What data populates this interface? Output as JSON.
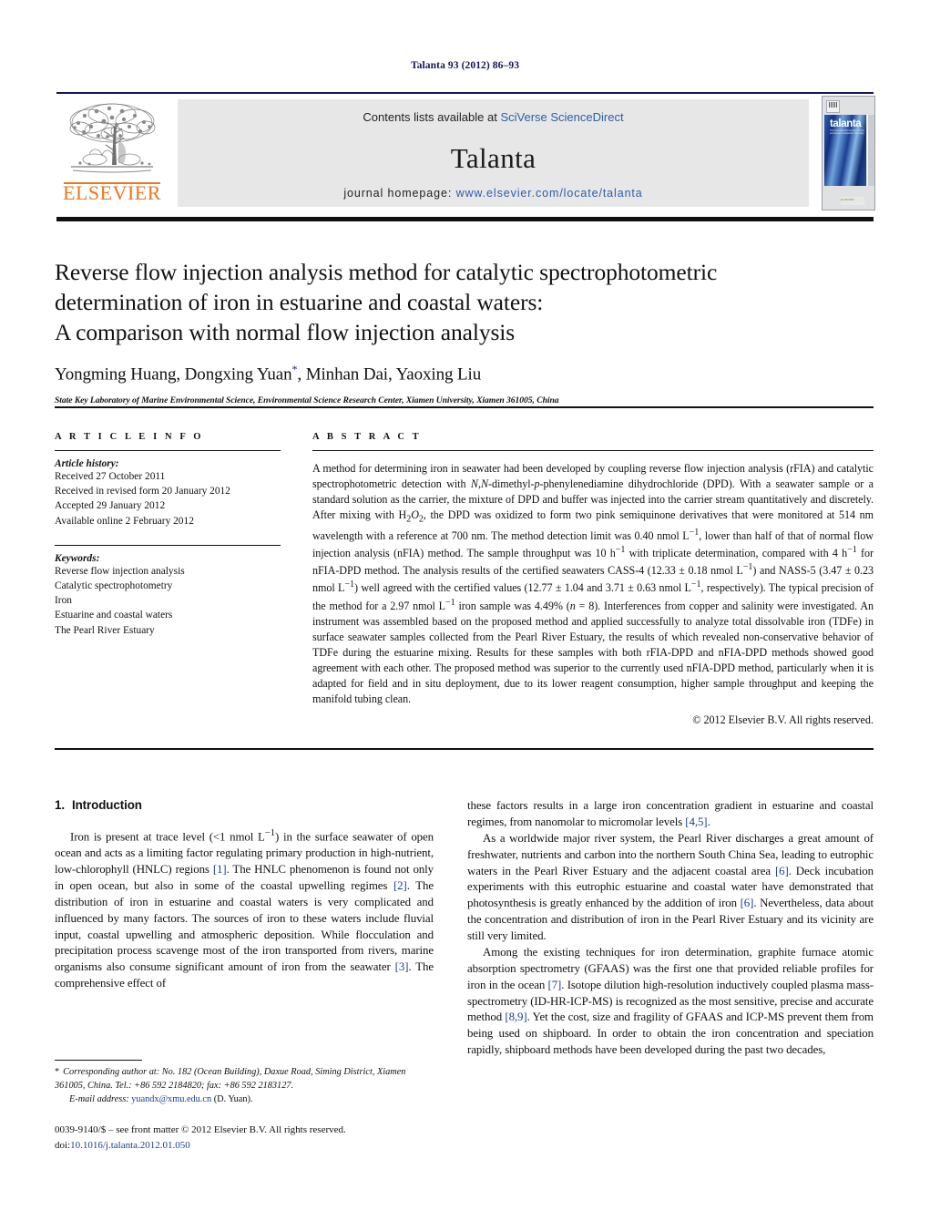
{
  "running_head": "Talanta 93 (2012) 86–93",
  "masthead": {
    "publisher": "ELSEVIER",
    "contents_prefix": "Contents lists available at ",
    "contents_link": "SciVerse ScienceDirect",
    "journal_name": "Talanta",
    "homepage_prefix": "journal homepage: ",
    "homepage_url": "www.elsevier.com/locate/talanta",
    "cover_title": "talanta",
    "cover_subtitle": "The International Journal of Pure and Applied Analytical Chemistry"
  },
  "article": {
    "title_lines": [
      "Reverse flow injection analysis method for catalytic spectrophotometric",
      "determination of iron in estuarine and coastal waters:",
      "A comparison with normal flow injection analysis"
    ],
    "authors": "Yongming Huang, Dongxing Yuan",
    "authors_marker": "*",
    "authors_rest": ", Minhan Dai, Yaoxing Liu",
    "affiliation": "State Key Laboratory of Marine Environmental Science, Environmental Science Research Center, Xiamen University, Xiamen 361005, China"
  },
  "article_info": {
    "heading": "A R T I C L E    I N F O",
    "history_label": "Article history:",
    "history": [
      "Received 27 October 2011",
      "Received in revised form 20 January 2012",
      "Accepted 29 January 2012",
      "Available online 2 February 2012"
    ],
    "keywords_label": "Keywords:",
    "keywords": [
      "Reverse flow injection analysis",
      "Catalytic spectrophotometry",
      "Iron",
      "Estuarine and coastal waters",
      "The Pearl River Estuary"
    ]
  },
  "abstract": {
    "heading": "A B S T R A C T",
    "text_part1": "A method for determining iron in seawater had been developed by coupling reverse flow injection analysis (rFIA) and catalytic spectrophotometric detection with ",
    "ital1": "N",
    "text_part2": ",",
    "ital2": "N",
    "text_part3": "-dimethyl-",
    "ital3": "p",
    "text_part4": "-phenylenediamine dihydrochloride (DPD). With a seawater sample or a standard solution as the carrier, the mixture of DPD and buffer was injected into the carrier stream quantitatively and discretely. After mixing with ",
    "h2o2": "H2O2",
    "text_part5": ", the DPD was oxidized to form two pink semiquinone derivatives that were monitored at 514 nm wavelength with a reference at 700 nm. The method detection limit was 0.40 nmol L",
    "sup1": "−1",
    "text_part6": ", lower than half of that of normal flow injection analysis (nFIA) method. The sample throughput was 10 h",
    "sup2": "−1",
    "text_part7": " with triplicate determination, compared with 4 h",
    "sup3": "−1",
    "text_part8": " for nFIA-DPD method. The analysis results of the certified seawaters CASS-4 (12.33 ± 0.18 nmol L",
    "sup4": "−1",
    "text_part9": ") and NASS-5 (3.47 ± 0.23 nmol L",
    "sup5": "−1",
    "text_part10": ") well agreed with the certified values (12.77 ± 1.04 and 3.71 ± 0.63 nmol L",
    "sup6": "−1",
    "text_part11": ", respectively). The typical precision of the method for a 2.97 nmol L",
    "sup7": "−1",
    "text_part12": " iron sample was 4.49% (",
    "ital_n": "n",
    "text_part13": " = 8). Interferences from copper and salinity were investigated. An instrument was assembled based on the proposed method and applied successfully to analyze total dissolvable iron (TDFe) in surface seawater samples collected from the Pearl River Estuary, the results of which revealed non-conservative behavior of TDFe during the estuarine mixing. Results for these samples with both rFIA-DPD and nFIA-DPD methods showed good agreement with each other. The proposed method was superior to the currently used nFIA-DPD method, particularly when it is adapted for field and in situ deployment, due to its lower reagent consumption, higher sample throughput and keeping the manifold tubing clean.",
    "copyright": "© 2012 Elsevier B.V. All rights reserved."
  },
  "introduction": {
    "section_number": "1.",
    "section_title": "Introduction",
    "left_p1_a": "Iron is present at trace level (<1 nmol L",
    "left_p1_sup": "−1",
    "left_p1_b": ") in the surface seawater of open ocean and acts as a limiting factor regulating primary production in high-nutrient, low-chlorophyll (HNLC) regions ",
    "ref1": "[1]",
    "left_p1_c": ". The HNLC phenomenon is found not only in open ocean, but also in some of the coastal upwelling regimes ",
    "ref2": "[2]",
    "left_p1_d": ". The distribution of iron in estuarine and coastal waters is very complicated and influenced by many factors. The sources of iron to these waters include fluvial input, coastal upwelling and atmospheric deposition. While flocculation and precipitation process scavenge most of the iron transported from rivers, marine organisms also consume significant amount of iron from the seawater ",
    "ref3": "[3]",
    "left_p1_e": ". The comprehensive effect of",
    "right_p1_a": "these factors results in a large iron concentration gradient in estuarine and coastal regimes, from nanomolar to micromolar levels ",
    "ref45": "[4,5]",
    "right_p1_b": ".",
    "right_p2_a": "As a worldwide major river system, the Pearl River discharges a great amount of freshwater, nutrients and carbon into the northern South China Sea, leading to eutrophic waters in the Pearl River Estuary and the adjacent coastal area ",
    "ref6a": "[6]",
    "right_p2_b": ". Deck incubation experiments with this eutrophic estuarine and coastal water have demonstrated that photosynthesis is greatly enhanced by the addition of iron ",
    "ref6b": "[6]",
    "right_p2_c": ". Nevertheless, data about the concentration and distribution of iron in the Pearl River Estuary and its vicinity are still very limited.",
    "right_p3_a": "Among the existing techniques for iron determination, graphite furnace atomic absorption spectrometry (GFAAS) was the first one that provided reliable profiles for iron in the ocean ",
    "ref7": "[7]",
    "right_p3_b": ". Isotope dilution high-resolution inductively coupled plasma mass-spectrometry (ID-HR-ICP-MS) is recognized as the most sensitive, precise and accurate method ",
    "ref89": "[8,9]",
    "right_p3_c": ". Yet the cost, size and fragility of GFAAS and ICP-MS prevent them from being used on shipboard. In order to obtain the iron concentration and speciation rapidly, shipboard methods have been developed during the past two decades,"
  },
  "footnote": {
    "star": "*",
    "corresponding": "Corresponding author at: No. 182 (Ocean Building), Daxue Road, Siming District, Xiamen 361005, China. Tel.: +86 592 2184820; fax: +86 592 2183127.",
    "email_label": "E-mail address:",
    "email": "yuandx@xmu.edu.cn",
    "email_owner": "(D. Yuan)."
  },
  "issn": {
    "line1": "0039-9140/$ – see front matter © 2012 Elsevier B.V. All rights reserved.",
    "doi_label": "doi:",
    "doi": "10.1016/j.talanta.2012.01.050"
  },
  "colors": {
    "link_blue": "#1a3f8f",
    "masthead_blue": "#2b5fa8",
    "elsevier_orange": "#e87722",
    "running_head": "#14145a"
  }
}
